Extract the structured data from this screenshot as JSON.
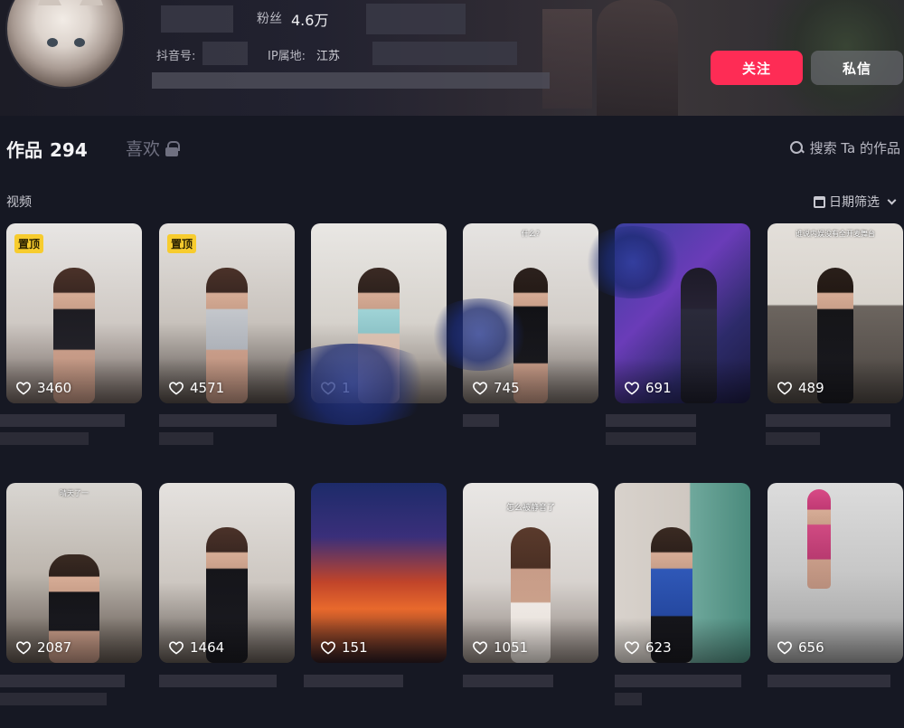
{
  "profile": {
    "fans_label": "粉丝",
    "fans_value": "4.6万",
    "douyin_id_label": "抖音号:",
    "ip_label": "IP属地:",
    "ip_value": "江苏",
    "follow_label": "关注",
    "message_label": "私信"
  },
  "tabs": {
    "works_label": "作品",
    "works_count": "294",
    "likes_label": "喜欢",
    "search_label": "搜索 Ta 的作品"
  },
  "section": {
    "label": "视频",
    "filter_label": "日期筛选"
  },
  "colors": {
    "accent": "#fe2c55",
    "pin_badge": "#f7cc2e",
    "background": "#161823"
  },
  "videos": [
    {
      "likes": "3460",
      "pinned": "置顶",
      "caption": ""
    },
    {
      "likes": "4571",
      "pinned": "置顶",
      "caption": ""
    },
    {
      "likes": "1",
      "pinned": "",
      "caption": ""
    },
    {
      "likes": "745",
      "pinned": "",
      "caption": "什么?"
    },
    {
      "likes": "691",
      "pinned": "",
      "caption": ""
    },
    {
      "likes": "489",
      "pinned": "",
      "caption": "谁说内娱没有全开麦舞台"
    },
    {
      "likes": "2087",
      "pinned": "",
      "caption": "晴天了一"
    },
    {
      "likes": "1464",
      "pinned": "",
      "caption": ""
    },
    {
      "likes": "151",
      "pinned": "",
      "caption": ""
    },
    {
      "likes": "1051",
      "pinned": "",
      "caption": "怎么被静音了"
    },
    {
      "likes": "623",
      "pinned": "",
      "caption": ""
    },
    {
      "likes": "656",
      "pinned": "",
      "caption": ""
    }
  ]
}
